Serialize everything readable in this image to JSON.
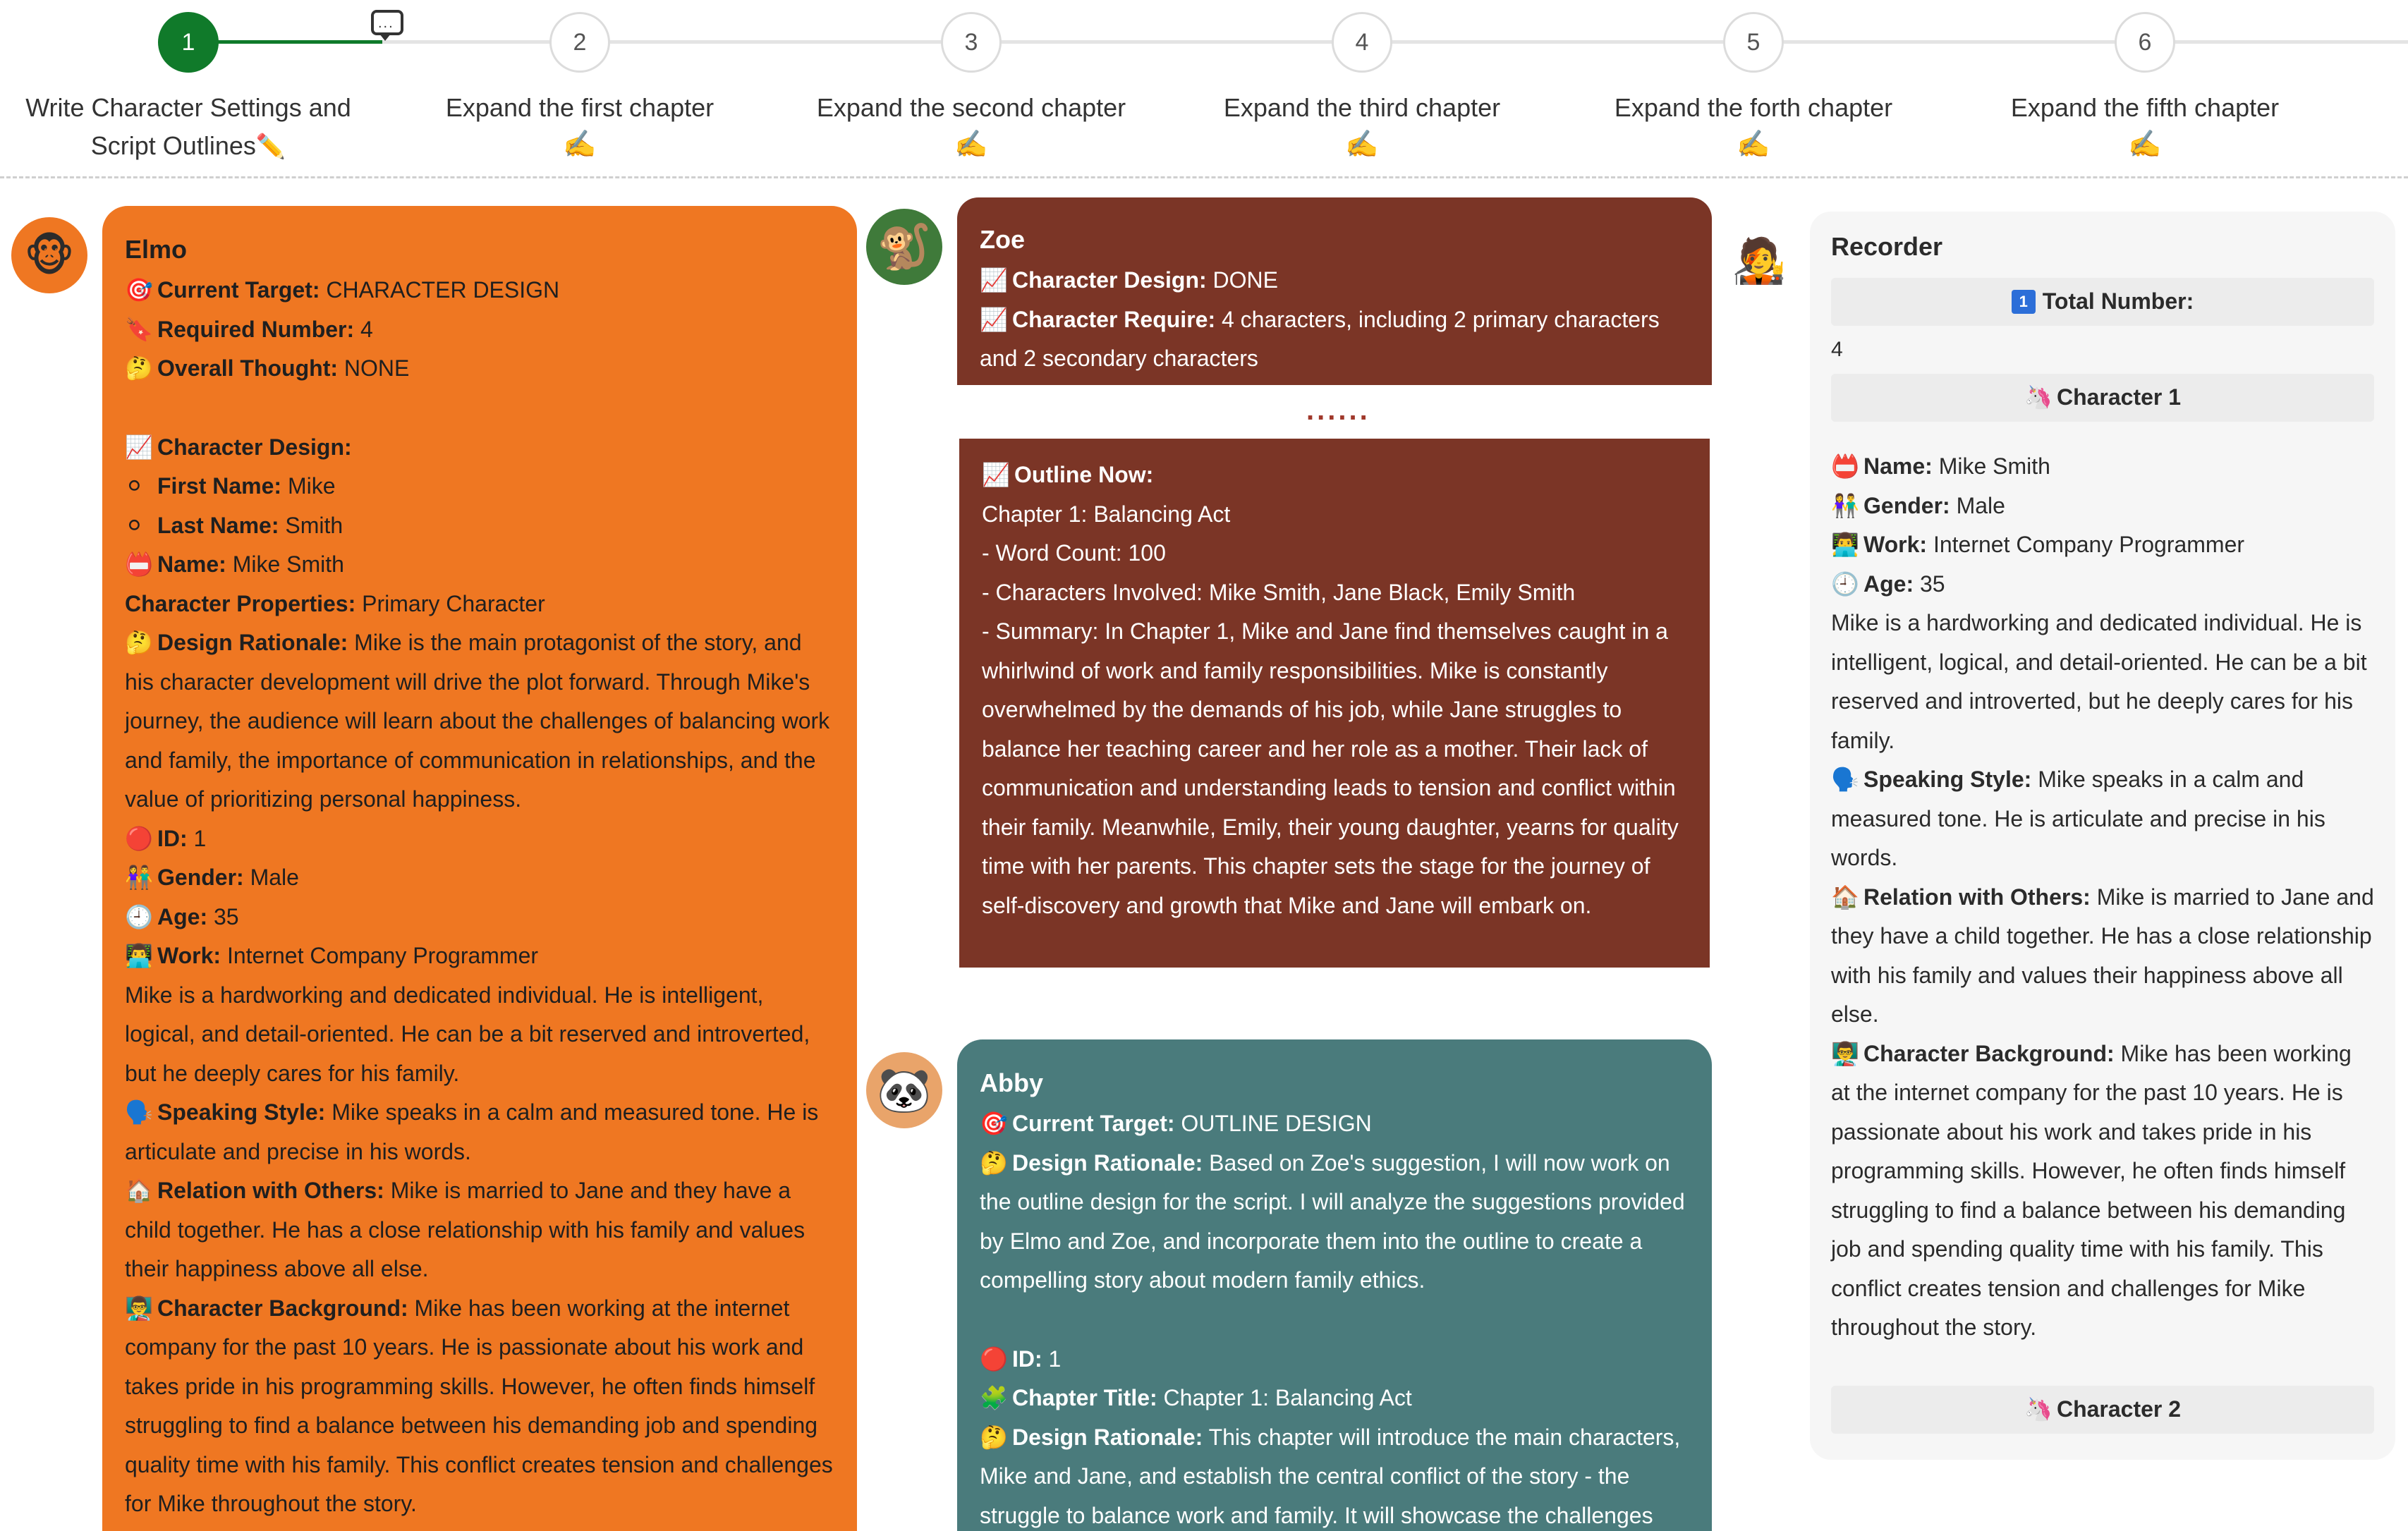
{
  "stepper": {
    "steps": [
      {
        "number": "1",
        "label_line1": "Write Character Settings and",
        "label_line2": "Script Outlines",
        "emoji": "✏️"
      },
      {
        "number": "2",
        "label": "Expand the first chapter",
        "emoji": "✍️"
      },
      {
        "number": "3",
        "label": "Expand the second chapter",
        "emoji": "✍️"
      },
      {
        "number": "4",
        "label": "Expand the third chapter",
        "emoji": "✍️"
      },
      {
        "number": "5",
        "label": "Expand the forth chapter",
        "emoji": "✍️"
      },
      {
        "number": "6",
        "label": "Expand the fifth chapter",
        "emoji": "✍️"
      }
    ],
    "active_step": 1,
    "colors": {
      "active": "#107a2a",
      "inactive_line": "#e4e4e4"
    }
  },
  "elmo": {
    "avatar": "🐵",
    "name": "Elmo",
    "current_target_label": "Current Target:",
    "current_target": "CHARACTER DESIGN",
    "required_number_label": "Required Number:",
    "required_number": "4",
    "overall_thought_label": "Overall Thought:",
    "overall_thought": "NONE",
    "character_design_label": "Character Design:",
    "first_name_label": "First Name:",
    "first_name": "Mike",
    "last_name_label": "Last Name:",
    "last_name": "Smith",
    "name_label": "Name:",
    "full_name": "Mike Smith",
    "properties_label": "Character Properties:",
    "properties": "Primary Character",
    "rationale_label": "Design Rationale:",
    "rationale": "Mike is the main protagonist of the story, and his character development will drive the plot forward. Through Mike's journey, the audience will learn about the challenges of balancing work and family, the importance of communication in relationships, and the value of prioritizing personal happiness.",
    "id_label": "ID:",
    "id": "1",
    "gender_label": "Gender:",
    "gender": "Male",
    "age_label": "Age:",
    "age": "35",
    "work_label": "Work:",
    "work": "Internet Company Programmer",
    "description": "Mike is a hardworking and dedicated individual. He is intelligent, logical, and detail-oriented. He can be a bit reserved and introverted, but he deeply cares for his family.",
    "speaking_label": "Speaking Style:",
    "speaking": "Mike speaks in a calm and measured tone. He is articulate and precise in his words.",
    "relation_label": "Relation with Others:",
    "relation": "Mike is married to Jane and they have a child together. He has a close relationship with his family and values their happiness above all else.",
    "background_label": "Character Background:",
    "background": "Mike has been working at the internet company for the past 10 years. He is passionate about his work and takes pride in his programming skills. However, he often finds himself struggling to find a balance between his demanding job and spending quality time with his family. This conflict creates tension and challenges for Mike throughout the story.",
    "color": "#ef7722"
  },
  "zoe": {
    "avatar": "🐒",
    "name": "Zoe",
    "design_label": "Character Design:",
    "design": "DONE",
    "require_label": "Character Require:",
    "require": "4 characters, including 2 primary characters and 2 secondary characters",
    "ellipsis": "......",
    "outline_label": "Outline Now:",
    "outline_chapter": "Chapter 1: Balancing Act",
    "outline_word_count": "- Word Count: 100",
    "outline_characters": "- Characters Involved: Mike Smith, Jane Black, Emily Smith",
    "outline_summary": "- Summary: In Chapter 1, Mike and Jane find themselves caught in a whirlwind of work and family responsibilities. Mike is constantly overwhelmed by the demands of his job, while Jane struggles to balance her teaching career and her role as a mother. Their lack of communication and understanding leads to tension and conflict within their family. Meanwhile, Emily, their young daughter, yearns for quality time with her parents. This chapter sets the stage for the journey of self-discovery and growth that Mike and Jane will embark on.",
    "color": "#7b3526"
  },
  "abby": {
    "avatar": "🐼",
    "name": "Abby",
    "current_target_label": "Current Target:",
    "current_target": "OUTLINE DESIGN",
    "rationale_label": "Design Rationale:",
    "rationale": "Based on Zoe's suggestion, I will now work on the outline design for the script. I will analyze the suggestions provided by Elmo and Zoe, and incorporate them into the outline to create a compelling story about modern family ethics.",
    "id_label": "ID:",
    "id": "1",
    "chapter_title_label": "Chapter Title:",
    "chapter_title": "Chapter 1: Balancing Act",
    "rationale2_label": "Design Rationale:",
    "rationale2": "This chapter will introduce the main characters, Mike and Jane, and establish the central conflict of the story - the struggle to balance work and family. It will showcase the challenges",
    "color": "#4a7b7c"
  },
  "recorder": {
    "avatar": "🧑‍🎤",
    "name": "Recorder",
    "total_label": "Total Number:",
    "total_icon": "1",
    "total": "4",
    "char1_label": "Character 1",
    "name_label": "Name:",
    "full_name": "Mike Smith",
    "gender_label": "Gender:",
    "gender": "Male",
    "work_label": "Work:",
    "work": "Internet Company Programmer",
    "age_label": "Age:",
    "age": "35",
    "description": "Mike is a hardworking and dedicated individual. He is intelligent, logical, and detail-oriented. He can be a bit reserved and introverted, but he deeply cares for his family.",
    "speaking_label": "Speaking Style:",
    "speaking": "Mike speaks in a calm and measured tone. He is articulate and precise in his words.",
    "relation_label": "Relation with Others:",
    "relation": "Mike is married to Jane and they have a child together. He has a close relationship with his family and values their happiness above all else.",
    "background_label": "Character Background:",
    "background": "Mike has been working at the internet company for the past 10 years. He is passionate about his work and takes pride in his programming skills. However, he often finds himself struggling to find a balance between his demanding job and spending quality time with his family. This conflict creates tension and challenges for Mike throughout the story.",
    "char2_label": "Character 2"
  },
  "icons": {
    "target": "🎯",
    "required": "🔖",
    "thought": "🤔",
    "chart": "📈",
    "circle": "⚪",
    "name": "📛",
    "red_circle": "🔴",
    "gender": "👫",
    "clock": "🕘",
    "work": "👨‍💻",
    "speaking": "🗣️",
    "relation": "🏠",
    "background": "👨‍🏫",
    "puzzle": "🧩",
    "unicorn": "🦄"
  }
}
